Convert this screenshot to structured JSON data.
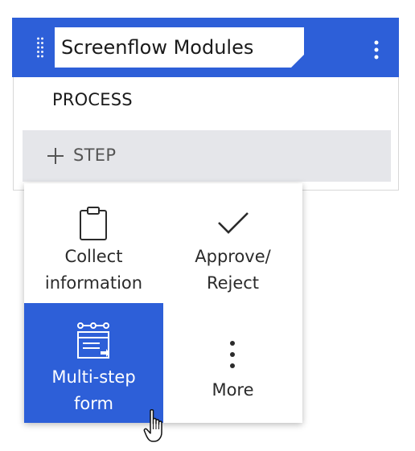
{
  "stage": {
    "title": "Screenflow Modules"
  },
  "process": {
    "label": "PROCESS",
    "add_step_label": "STEP"
  },
  "menu": {
    "items": [
      {
        "line1": "Collect",
        "line2": "information",
        "icon": "clipboard-icon"
      },
      {
        "line1": "Approve/",
        "line2": "Reject",
        "icon": "checkmark-icon"
      },
      {
        "line1": "Multi-step",
        "line2": "form",
        "icon": "multistep-form-icon",
        "selected": true
      },
      {
        "line1": "More",
        "icon": "more-vertical-icon"
      }
    ]
  },
  "colors": {
    "accent": "#2d5fd8",
    "step_row_bg": "#e5e6ea"
  }
}
